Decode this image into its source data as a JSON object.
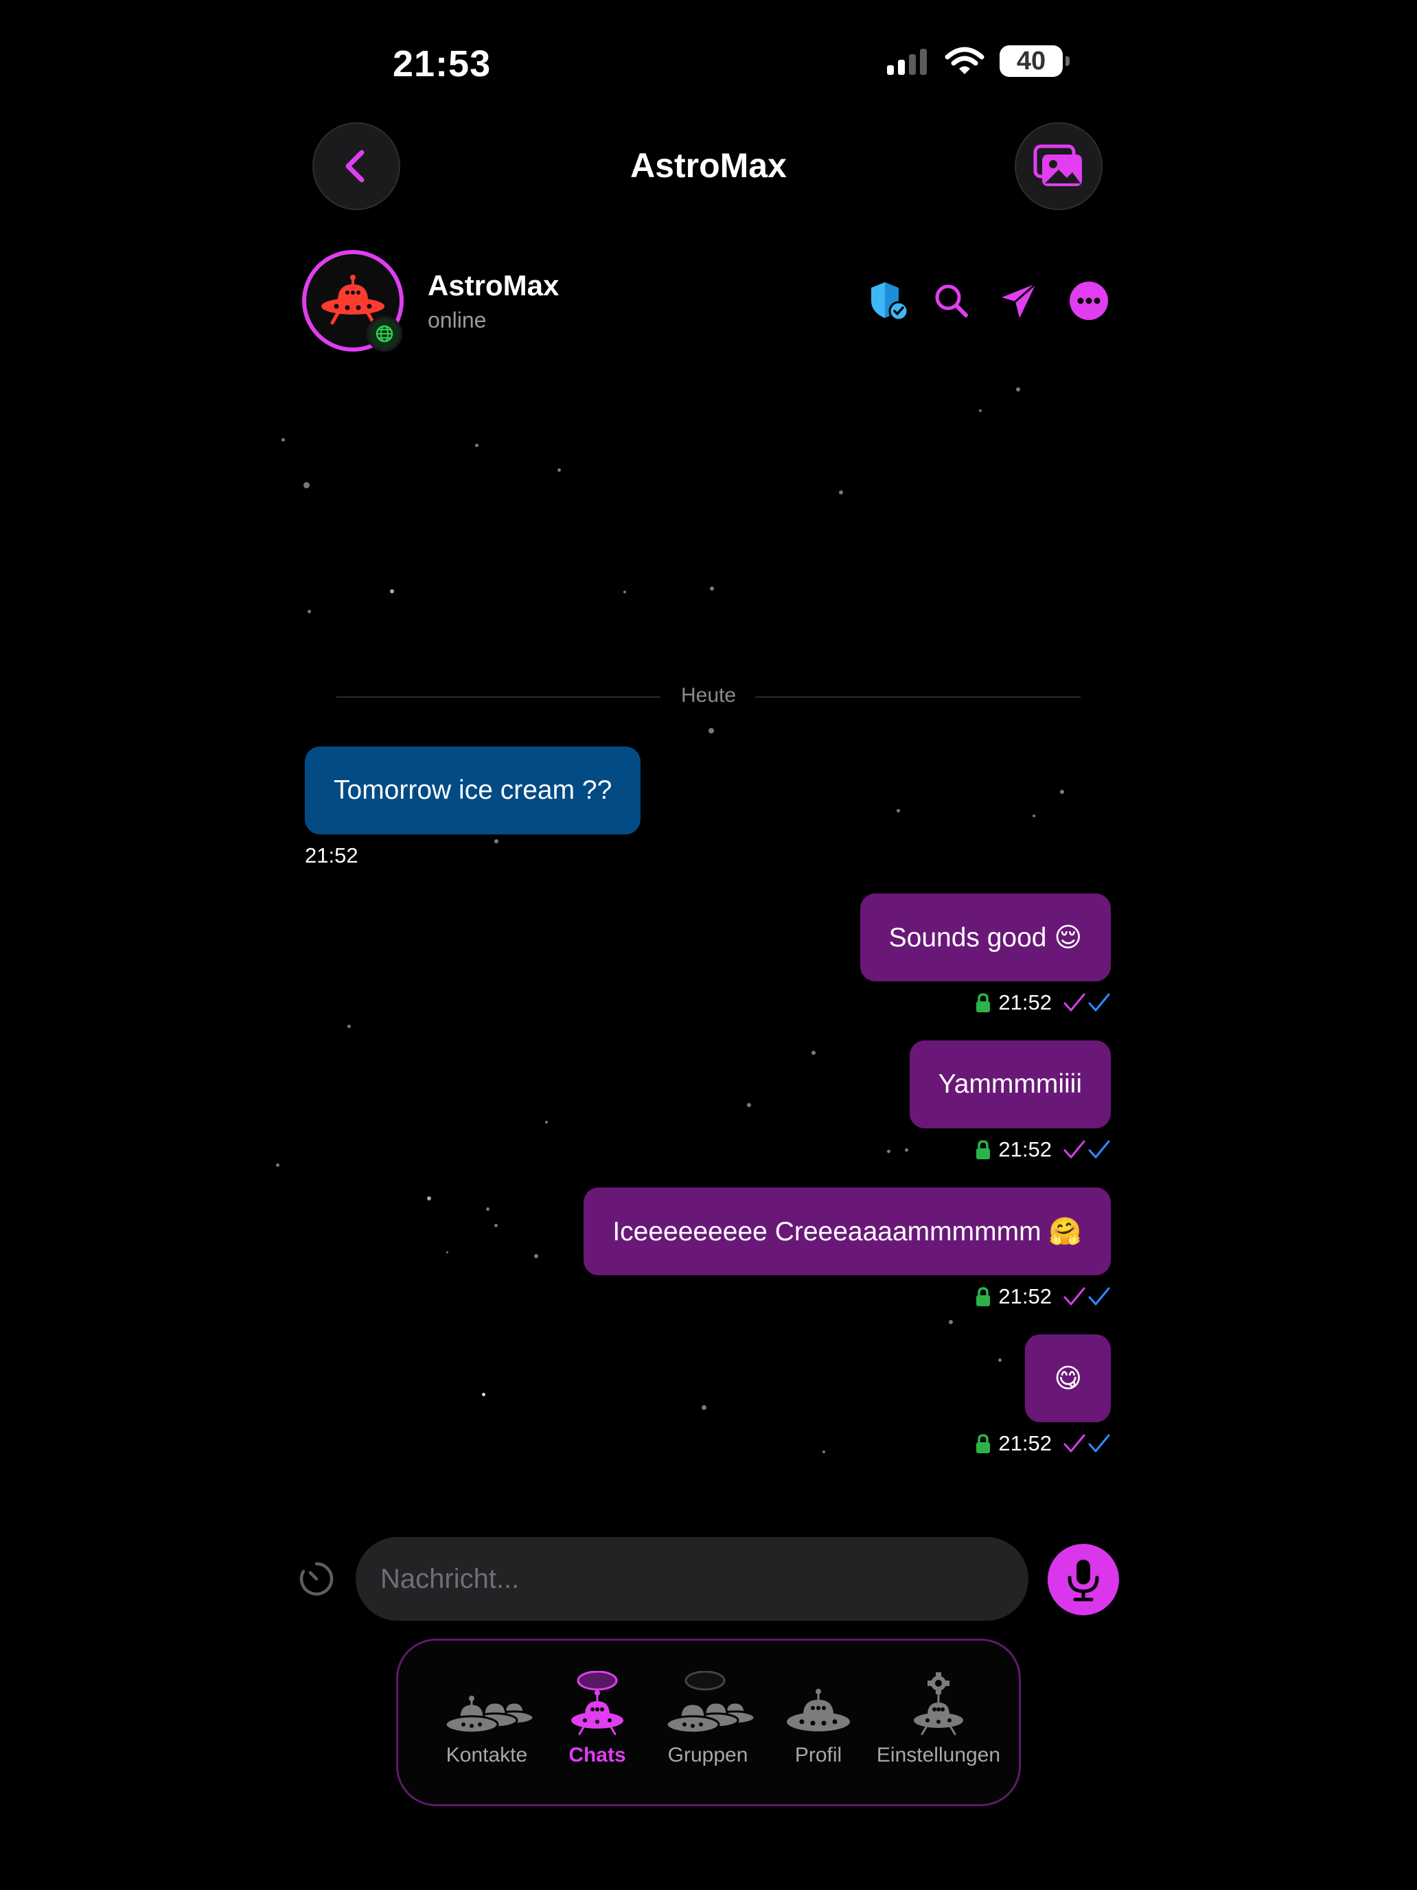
{
  "status_bar": {
    "time": "21:53",
    "battery": "40"
  },
  "nav": {
    "title": "AstroMax",
    "back_icon": "chevron-left-icon",
    "gallery_icon": "photos-icon"
  },
  "contact": {
    "name": "AstroMax",
    "status": "online",
    "actions": [
      "shield-check-icon",
      "search-icon",
      "send-icon",
      "more-icon"
    ]
  },
  "date_separator": "Heute",
  "messages": [
    {
      "direction": "incoming",
      "text": "Tomorrow ice cream ??",
      "time": "21:52"
    },
    {
      "direction": "outgoing",
      "text": "Sounds good 😌",
      "time": "21:52"
    },
    {
      "direction": "outgoing",
      "text": "Yammmmiiii",
      "time": "21:52"
    },
    {
      "direction": "outgoing",
      "text": "Iceeeeeeeee Creeeaaaammmmmm 🤗",
      "time": "21:52"
    },
    {
      "direction": "outgoing",
      "text": "😋",
      "time": "21:52"
    }
  ],
  "composer": {
    "placeholder": "Nachricht..."
  },
  "tabs": [
    {
      "label": "Kontakte",
      "active": false
    },
    {
      "label": "Chats",
      "active": true
    },
    {
      "label": "Gruppen",
      "active": false
    },
    {
      "label": "Profil",
      "active": false
    },
    {
      "label": "Einstellungen",
      "active": false
    }
  ],
  "colors": {
    "accent": "#e03ef0",
    "incoming_bubble": "#024b85",
    "outgoing_bubble": "#6a1878",
    "read_tick_pink": "#d23fe6",
    "read_tick_blue": "#2f8cff",
    "lock_green": "#2bb34a"
  }
}
